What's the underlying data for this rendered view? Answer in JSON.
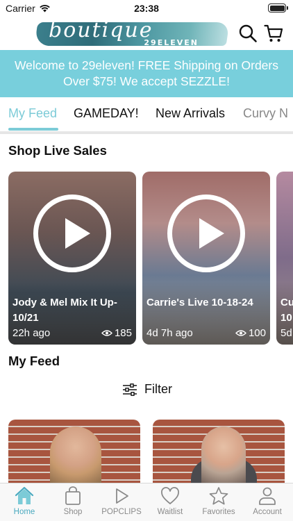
{
  "status_bar": {
    "carrier": "Carrier",
    "time": "23:38"
  },
  "header": {
    "logo_script": "boutique",
    "logo_sub": "29ELEVEN",
    "icons": [
      "search-icon",
      "cart-icon"
    ]
  },
  "banner": {
    "line1": "Welcome to 29eleven! FREE Shipping on Orders",
    "line2": "Over $75! We accept SEZZLE!"
  },
  "tabs": [
    {
      "label": "My Feed",
      "active": true
    },
    {
      "label": "GAMEDAY!"
    },
    {
      "label": "New Arrivals"
    },
    {
      "label": "Curvy N"
    }
  ],
  "live_sales": {
    "title": "Shop Live Sales",
    "cards": [
      {
        "title": "Jody & Mel Mix It Up- 10/21",
        "age": "22h ago",
        "views": "185"
      },
      {
        "title": "Carrie's Live 10-18-24",
        "age": "4d 7h ago",
        "views": "100"
      },
      {
        "title": "Cu 10",
        "age": "5d"
      }
    ]
  },
  "feed": {
    "title": "My Feed",
    "filter_label": "Filter"
  },
  "tab_bar": {
    "accent": "#4aa9bf",
    "items": [
      {
        "label": "Home",
        "icon": "home-icon",
        "active": true
      },
      {
        "label": "Shop",
        "icon": "bag-icon"
      },
      {
        "label": "POPCLIPS",
        "icon": "play-icon"
      },
      {
        "label": "Waitlist",
        "icon": "heart-icon"
      },
      {
        "label": "Favorites",
        "icon": "star-icon"
      },
      {
        "label": "Account",
        "icon": "person-icon"
      }
    ]
  },
  "colors": {
    "banner_bg": "#78cfdc",
    "tab_active": "#7ccbd7"
  }
}
